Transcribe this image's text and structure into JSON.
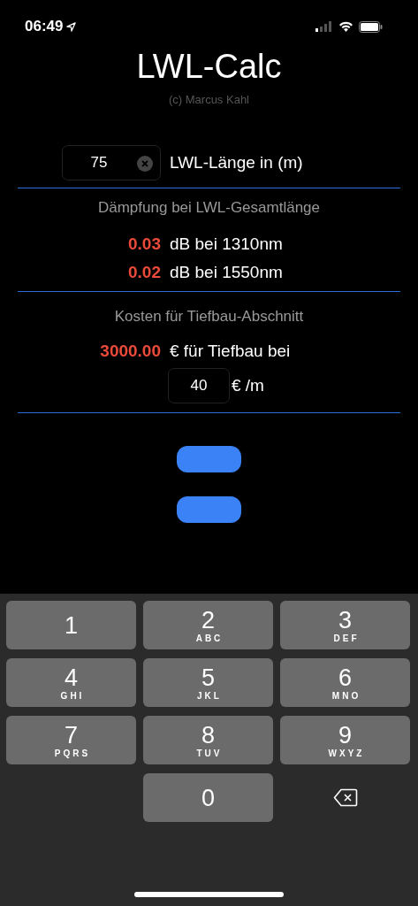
{
  "status_bar": {
    "time": "06:49"
  },
  "title": "LWL-Calc",
  "subtitle": "(c) Marcus Kahl",
  "length": {
    "value": "75",
    "label": "LWL-Länge in (m)"
  },
  "attenuation": {
    "heading": "Dämpfung bei LWL-Gesamtlänge",
    "rows": [
      {
        "value": "0.03",
        "label": "dB bei 1310nm"
      },
      {
        "value": "0.02",
        "label": "dB bei 1550nm"
      }
    ]
  },
  "costs": {
    "heading": "Kosten für Tiefbau-Abschnitt",
    "value": "3000.00",
    "label": "€ für Tiefbau bei",
    "rate": "40",
    "rate_unit": "€ /m"
  },
  "keyboard": {
    "keys": [
      {
        "kind": "digit",
        "digit": "1"
      },
      {
        "kind": "digit",
        "digit": "2",
        "letters": "ABC"
      },
      {
        "kind": "digit",
        "digit": "3",
        "letters": "DEF"
      },
      {
        "kind": "digit",
        "digit": "4",
        "letters": "GHI"
      },
      {
        "kind": "digit",
        "digit": "5",
        "letters": "JKL"
      },
      {
        "kind": "digit",
        "digit": "6",
        "letters": "MNO"
      },
      {
        "kind": "digit",
        "digit": "7",
        "letters": "PQRS"
      },
      {
        "kind": "digit",
        "digit": "8",
        "letters": "TUV"
      },
      {
        "kind": "digit",
        "digit": "9",
        "letters": "WXYZ"
      },
      {
        "kind": "digit",
        "digit": "0"
      },
      {
        "kind": "delete"
      }
    ]
  }
}
